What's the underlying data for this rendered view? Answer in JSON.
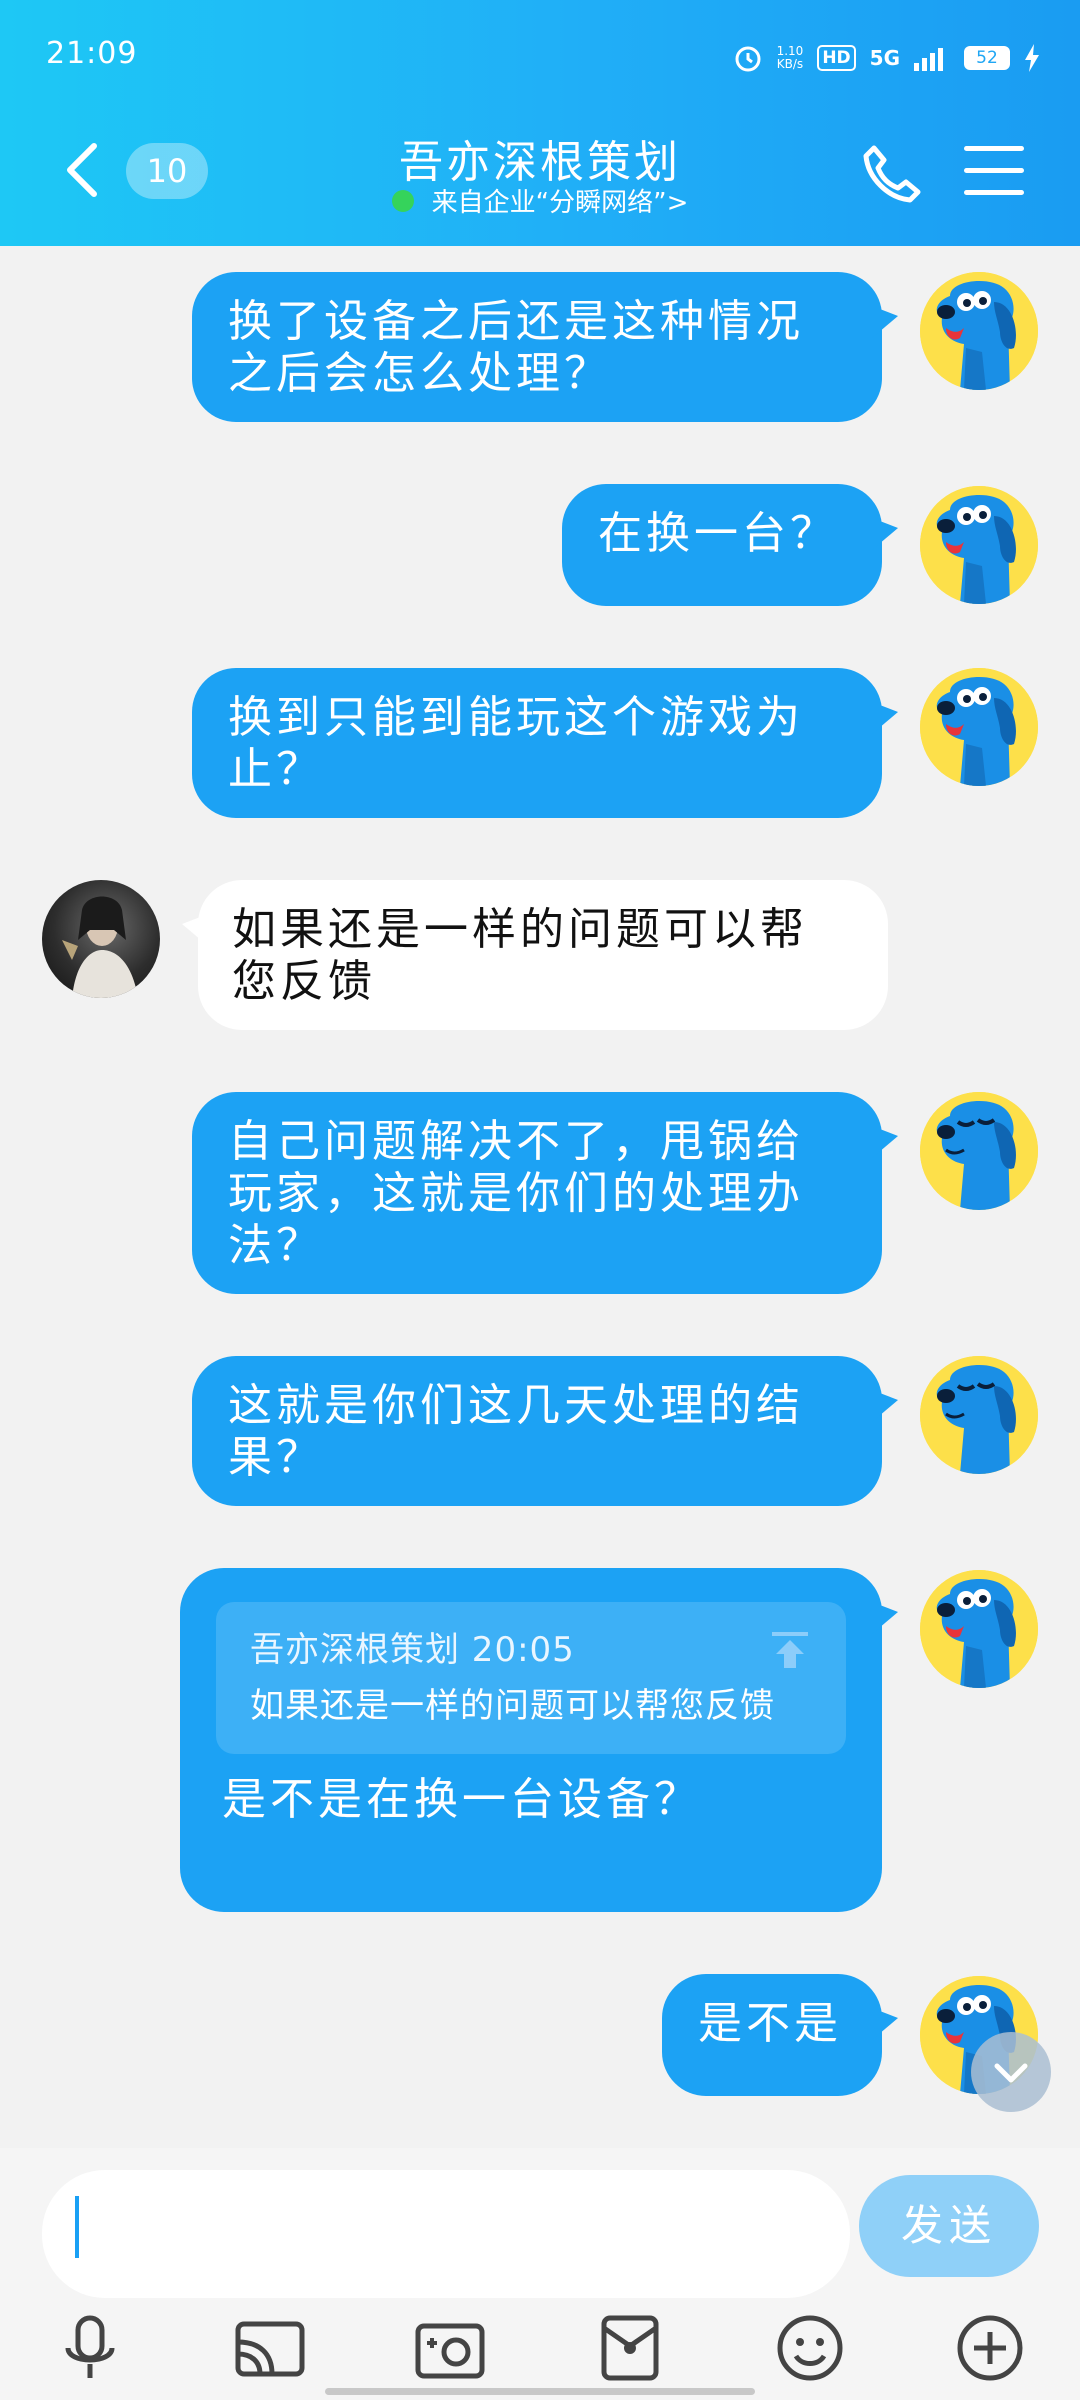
{
  "status_bar": {
    "time": "21:09",
    "net_speed_value": "1.10",
    "net_speed_unit": "KB/s",
    "hd": "HD",
    "network": "5G",
    "battery": "52"
  },
  "header": {
    "unread_count": "10",
    "title": "吾亦深根策划",
    "subtitle": "来自企业“分瞬网络”>"
  },
  "messages": [
    {
      "side": "out",
      "text": "换了设备之后还是这种情况之后会怎么处理？"
    },
    {
      "side": "out",
      "text": "在换一台？"
    },
    {
      "side": "out",
      "text": "换到只能到能玩这个游戏为止？"
    },
    {
      "side": "in",
      "text": "如果还是一样的问题可以帮您反馈"
    },
    {
      "side": "out",
      "text": " 自己问题解决不了，甩锅给玩家，这就是你们的处理办法？"
    },
    {
      "side": "out",
      "text": "这就是你们这几天处理的结果？"
    },
    {
      "side": "out",
      "quote_header": "吾亦深根策划 20:05",
      "quote_text": "如果还是一样的问题可以帮您反馈",
      "text": "是不是在换一台设备？"
    },
    {
      "side": "out",
      "text": "是不是"
    }
  ],
  "input": {
    "value": "",
    "send_label": "发送"
  },
  "toolbar": {
    "items": [
      "microphone-icon",
      "screen-cast-icon",
      "camera-icon",
      "red-packet-icon",
      "emoji-icon",
      "add-icon"
    ]
  },
  "colors": {
    "accent": "#1ca2f4",
    "header_gradient_start": "#1ec8f5",
    "background": "#f2f2f2",
    "send_disabled": "#8fd0f8"
  }
}
